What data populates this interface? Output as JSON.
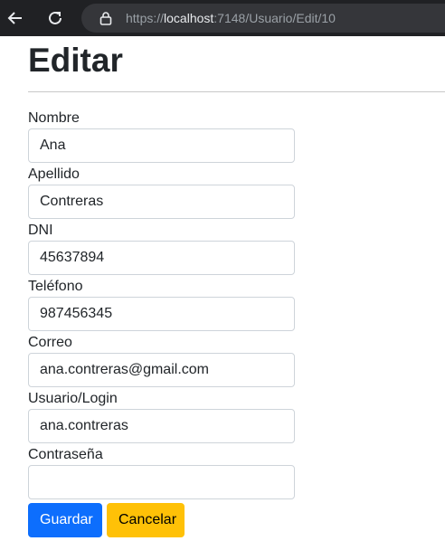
{
  "browser": {
    "url_prefix": "https://",
    "url_host": "localhost",
    "url_rest": ":7148/Usuario/Edit/10"
  },
  "page": {
    "title": "Editar"
  },
  "form": {
    "fields": [
      {
        "label": "Nombre",
        "value": "Ana"
      },
      {
        "label": "Apellido",
        "value": "Contreras"
      },
      {
        "label": "DNI",
        "value": "45637894"
      },
      {
        "label": "Teléfono",
        "value": "987456345"
      },
      {
        "label": "Correo",
        "value": "ana.contreras@gmail.com"
      },
      {
        "label": "Usuario/Login",
        "value": "ana.contreras"
      },
      {
        "label": "Contraseña",
        "value": ""
      }
    ],
    "save_label": "Guardar",
    "cancel_label": "Cancelar"
  },
  "colors": {
    "primary": "#0d6efd",
    "warning": "#ffc107",
    "browser_bar": "#202124"
  }
}
